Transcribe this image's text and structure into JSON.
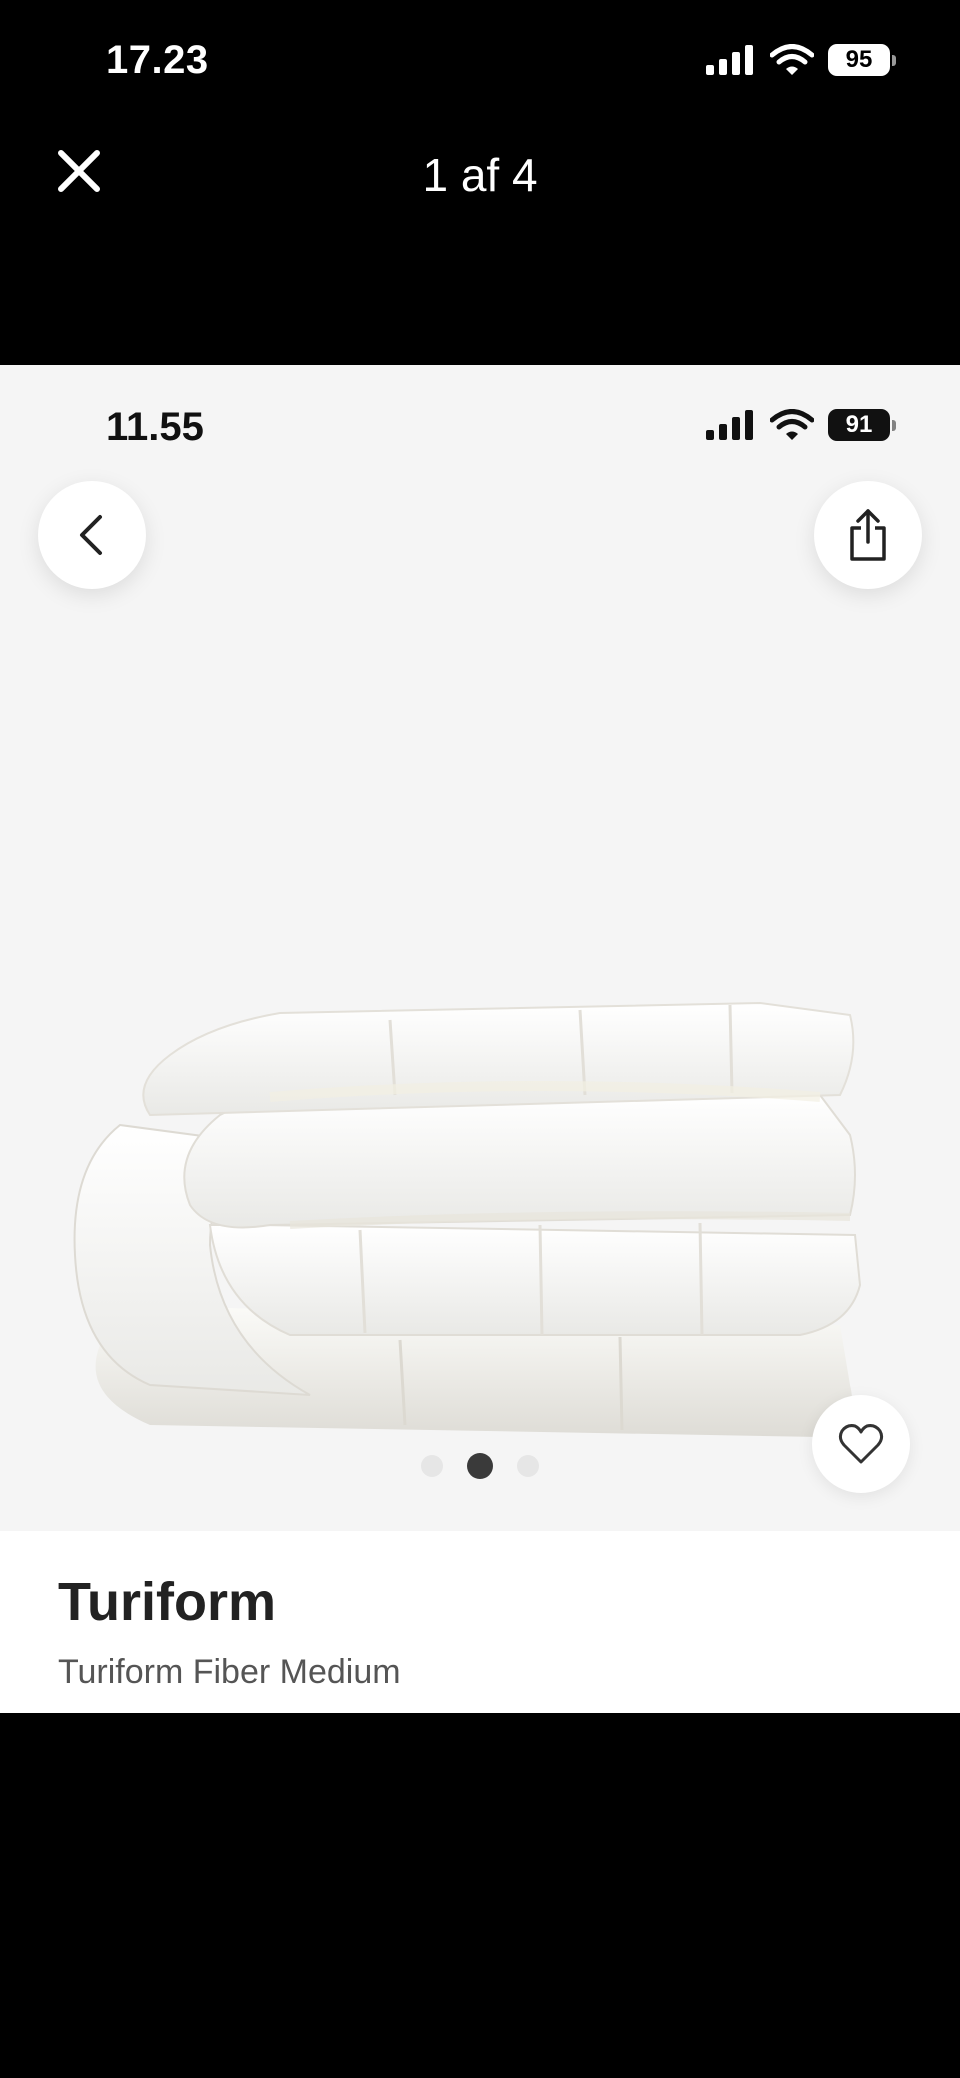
{
  "viewer": {
    "status_time": "17.23",
    "battery": "95",
    "counter": "1 af 4"
  },
  "screenshot": {
    "status_time": "11.55",
    "battery": "91",
    "carousel": {
      "total": 3,
      "active_index": 1
    },
    "product": {
      "brand": "Turiform",
      "name": "Turiform Fiber Medium"
    }
  },
  "colors": {
    "viewer_background": "#000000",
    "hero_background": "#f5f5f5",
    "dot_active": "#3a3a3a",
    "dot_inactive": "#e6e6e6"
  },
  "icons": [
    "signal-icon",
    "wifi-icon",
    "battery-icon",
    "close-icon",
    "back-chevron-icon",
    "share-icon",
    "heart-icon"
  ]
}
